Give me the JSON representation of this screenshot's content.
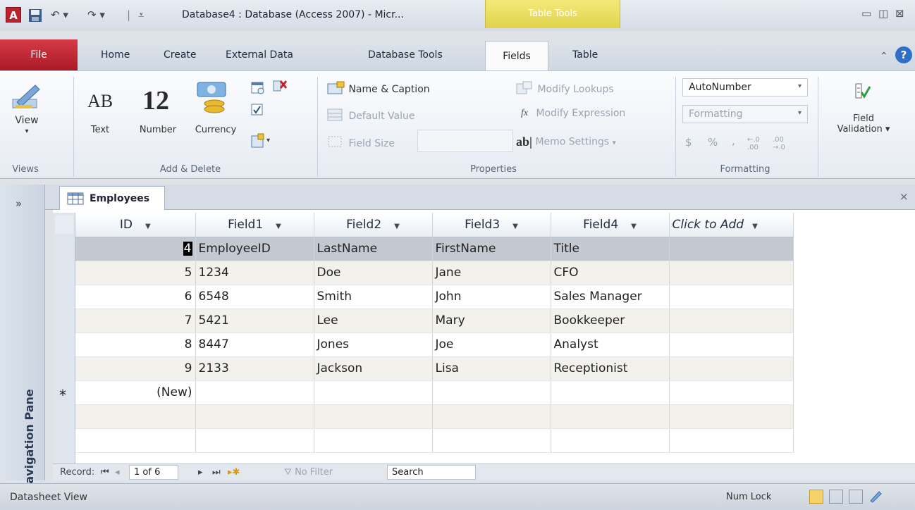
{
  "window": {
    "app_icon": "A",
    "title": "Database4 : Database (Access 2007) - Micr...",
    "contextual_group": "Table Tools"
  },
  "tabs": {
    "file": "File",
    "home": "Home",
    "create": "Create",
    "external_data": "External Data",
    "database_tools": "Database Tools",
    "fields": "Fields",
    "table": "Table"
  },
  "ribbon": {
    "views": {
      "view_label": "View",
      "group": "Views"
    },
    "add_delete": {
      "text_label": "Text",
      "text_glyph": "AB",
      "number_label": "Number",
      "number_glyph": "12",
      "currency_label": "Currency",
      "group": "Add & Delete"
    },
    "properties": {
      "name_caption": "Name & Caption",
      "default_value": "Default Value",
      "field_size": "Field Size",
      "modify_lookups": "Modify Lookups",
      "modify_expression": "Modify Expression",
      "memo_settings": "Memo Settings",
      "group": "Properties"
    },
    "formatting": {
      "data_type": "AutoNumber",
      "format": "Formatting",
      "symbols": [
        "$",
        "%",
        ","
      ],
      "group": "Formatting"
    },
    "validation": {
      "field_validation_line1": "Field",
      "field_validation_line2": "Validation"
    }
  },
  "nav_pane": {
    "collapse": "»",
    "label": "Navigation Pane"
  },
  "document": {
    "tab_label": "Employees",
    "close": "×"
  },
  "table": {
    "columns": [
      "ID",
      "Field1",
      "Field2",
      "Field3",
      "Field4",
      "Click to Add"
    ],
    "rows": [
      {
        "id": "4",
        "f1": "EmployeeID",
        "f2": "LastName",
        "f3": "FirstName",
        "f4": "Title"
      },
      {
        "id": "5",
        "f1": "1234",
        "f2": "Doe",
        "f3": "Jane",
        "f4": "CFO"
      },
      {
        "id": "6",
        "f1": "6548",
        "f2": "Smith",
        "f3": "John",
        "f4": "Sales Manager"
      },
      {
        "id": "7",
        "f1": "5421",
        "f2": "Lee",
        "f3": "Mary",
        "f4": "Bookkeeper"
      },
      {
        "id": "8",
        "f1": "8447",
        "f2": "Jones",
        "f3": "Joe",
        "f4": "Analyst"
      },
      {
        "id": "9",
        "f1": "2133",
        "f2": "Jackson",
        "f3": "Lisa",
        "f4": "Receptionist"
      }
    ],
    "new_row_marker": "*",
    "new_row_label": "(New)"
  },
  "record_nav": {
    "label": "Record:",
    "position": "1 of 6",
    "no_filter": "No Filter",
    "search": "Search"
  },
  "status": {
    "view_name": "Datasheet View",
    "num_lock": "Num Lock"
  }
}
